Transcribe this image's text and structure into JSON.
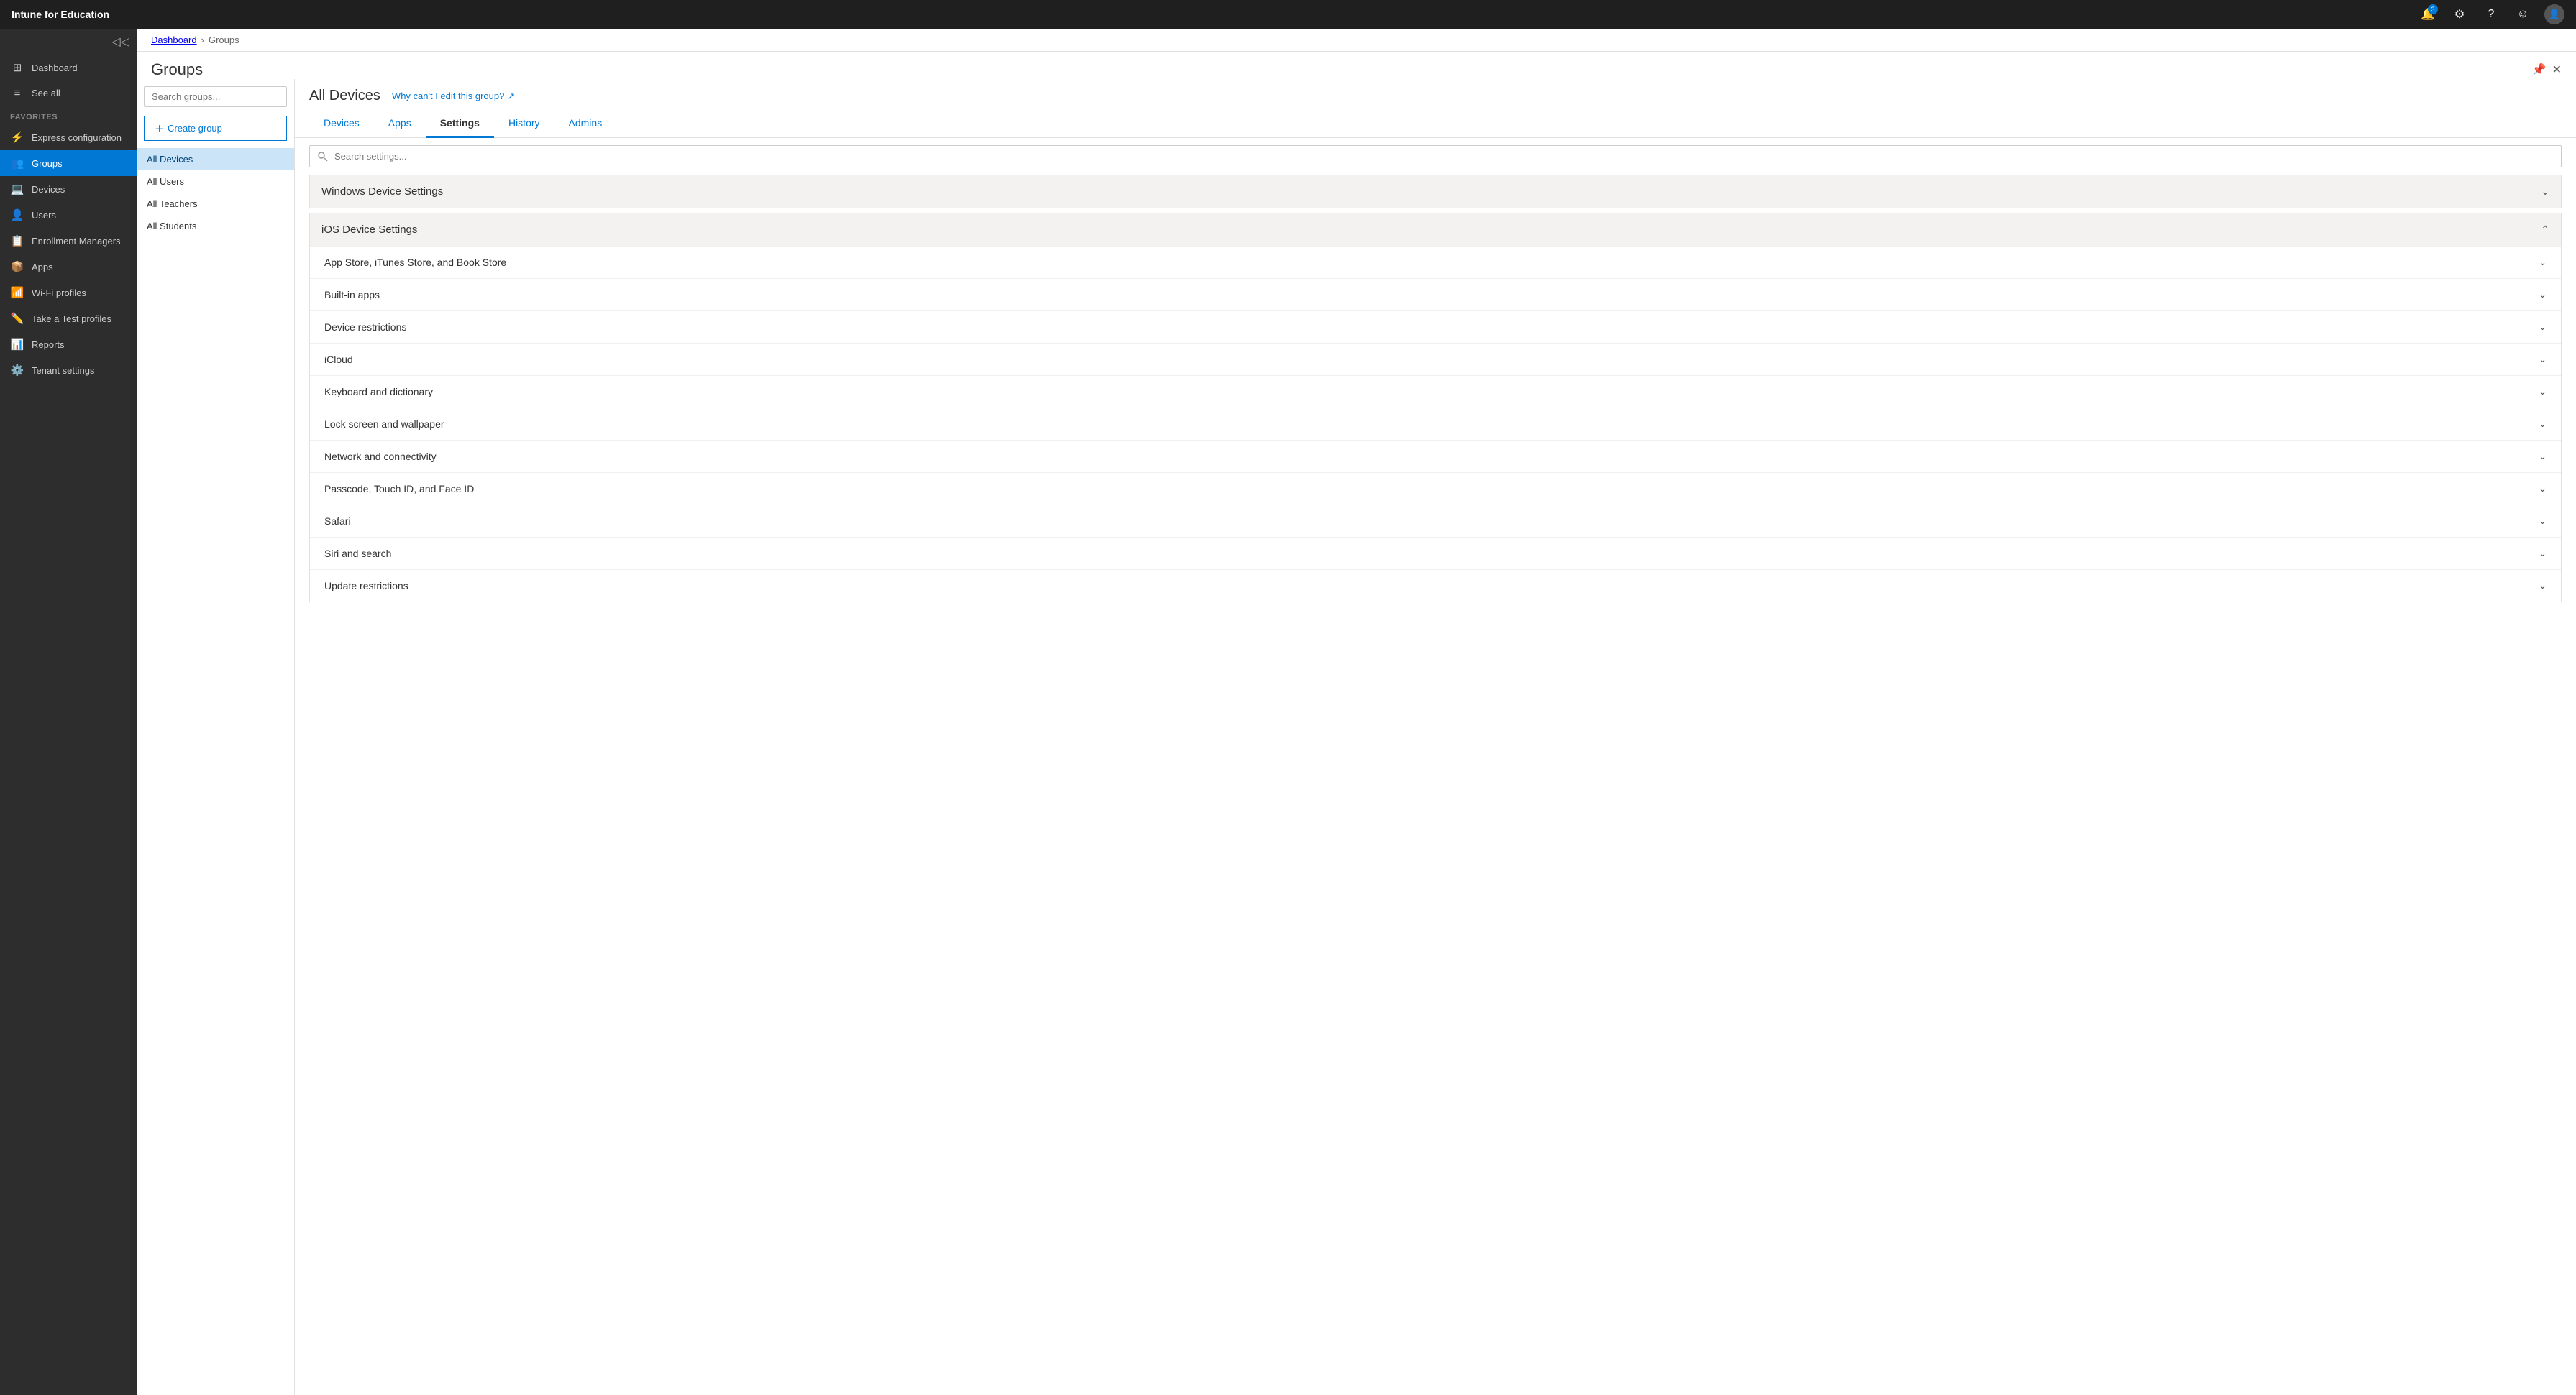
{
  "app": {
    "brand": "Intune for Education"
  },
  "topbar": {
    "notifications_badge": "3",
    "settings_label": "Settings",
    "help_label": "Help",
    "user_label": "User"
  },
  "sidebar": {
    "collapse_label": "Collapse",
    "items": [
      {
        "id": "dashboard",
        "label": "Dashboard",
        "icon": "⊞"
      },
      {
        "id": "see-all",
        "label": "See all",
        "icon": "≡"
      }
    ],
    "favorites_label": "FAVORITES",
    "favorites_items": [
      {
        "id": "express-config",
        "label": "Express configuration",
        "icon": "⚡"
      },
      {
        "id": "groups",
        "label": "Groups",
        "icon": "👥",
        "active": true
      },
      {
        "id": "devices",
        "label": "Devices",
        "icon": "💻"
      },
      {
        "id": "users",
        "label": "Users",
        "icon": "👤"
      },
      {
        "id": "enrollment-managers",
        "label": "Enrollment Managers",
        "icon": "📋"
      },
      {
        "id": "apps",
        "label": "Apps",
        "icon": "📦"
      },
      {
        "id": "wifi-profiles",
        "label": "Wi-Fi profiles",
        "icon": "📶"
      },
      {
        "id": "take-a-test",
        "label": "Take a Test profiles",
        "icon": "✏️"
      },
      {
        "id": "reports",
        "label": "Reports",
        "icon": "📊"
      },
      {
        "id": "tenant-settings",
        "label": "Tenant settings",
        "icon": "⚙️"
      }
    ]
  },
  "breadcrumb": {
    "items": [
      "Dashboard",
      "Groups"
    ],
    "separator": "›"
  },
  "page": {
    "title": "Groups",
    "pin_label": "Pin",
    "close_label": "Close"
  },
  "left_panel": {
    "search_placeholder": "Search groups...",
    "create_group_label": "Create group",
    "groups": [
      {
        "id": "all-devices",
        "label": "All Devices",
        "selected": true
      },
      {
        "id": "all-users",
        "label": "All Users"
      },
      {
        "id": "all-teachers",
        "label": "All Teachers"
      },
      {
        "id": "all-students",
        "label": "All Students"
      }
    ]
  },
  "right_panel": {
    "group_name": "All Devices",
    "edit_link_text": "Why can't I edit this group?",
    "edit_link_icon": "↗",
    "tabs": [
      {
        "id": "devices",
        "label": "Devices",
        "active": false
      },
      {
        "id": "apps",
        "label": "Apps",
        "active": false
      },
      {
        "id": "settings",
        "label": "Settings",
        "active": true
      },
      {
        "id": "history",
        "label": "History",
        "active": false
      },
      {
        "id": "admins",
        "label": "Admins",
        "active": false
      }
    ],
    "search_settings_placeholder": "Search settings...",
    "settings_sections": [
      {
        "id": "windows-device-settings",
        "label": "Windows Device Settings",
        "expanded": false,
        "items": []
      },
      {
        "id": "ios-device-settings",
        "label": "iOS Device Settings",
        "expanded": true,
        "items": [
          {
            "id": "app-store",
            "label": "App Store, iTunes Store, and Book Store"
          },
          {
            "id": "built-in-apps",
            "label": "Built-in apps"
          },
          {
            "id": "device-restrictions",
            "label": "Device restrictions"
          },
          {
            "id": "icloud",
            "label": "iCloud"
          },
          {
            "id": "keyboard-and-dictionary",
            "label": "Keyboard and dictionary"
          },
          {
            "id": "lock-screen",
            "label": "Lock screen and wallpaper"
          },
          {
            "id": "network-connectivity",
            "label": "Network and connectivity"
          },
          {
            "id": "passcode",
            "label": "Passcode, Touch ID, and Face ID"
          },
          {
            "id": "safari",
            "label": "Safari"
          },
          {
            "id": "siri-and-search",
            "label": "Siri and search"
          },
          {
            "id": "update-restrictions",
            "label": "Update restrictions"
          }
        ]
      }
    ]
  }
}
